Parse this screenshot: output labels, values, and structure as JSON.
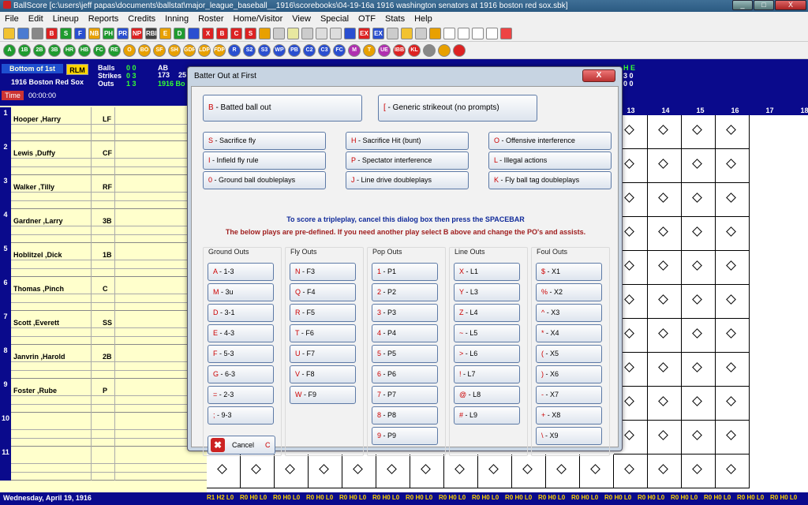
{
  "window": {
    "title": "BallScore   [c:\\users\\jeff papas\\documents\\ballstat\\major_league_baseball__1916\\scorebooks\\04-19-16a 1916 washington senators  at  1916 boston red sox.sbk]",
    "min": "_",
    "max": "□",
    "close": "X"
  },
  "menu": [
    "File",
    "Edit",
    "Lineup",
    "Reports",
    "Credits",
    "Inning",
    "Roster",
    "Home/Visitor",
    "View",
    "Special",
    "OTF",
    "Stats",
    "Help"
  ],
  "toolbar1": [
    {
      "t": "",
      "c": "#f2c230"
    },
    {
      "t": "",
      "c": "#4a7bd1"
    },
    {
      "t": "",
      "c": "#888"
    },
    {
      "t": "B",
      "c": "#d22"
    },
    {
      "t": "S",
      "c": "#1f9b2f"
    },
    {
      "t": "F",
      "c": "#2a4fd0"
    },
    {
      "t": "NB",
      "c": "#e8a000"
    },
    {
      "t": "PH",
      "c": "#1f9b2f"
    },
    {
      "t": "PR",
      "c": "#2a4fd0"
    },
    {
      "t": "NP",
      "c": "#d22"
    },
    {
      "t": "RBI",
      "c": "#444"
    },
    {
      "t": "E",
      "c": "#e8a000"
    },
    {
      "t": "D",
      "c": "#1f9b2f"
    },
    {
      "t": "",
      "c": "#2a4fd0"
    },
    {
      "t": "X",
      "c": "#d22"
    },
    {
      "t": "B",
      "c": "#d22"
    },
    {
      "t": "C",
      "c": "#d22"
    },
    {
      "t": "S",
      "c": "#d22"
    },
    {
      "t": "",
      "c": "#e8a000"
    },
    {
      "t": "",
      "c": "#ccc"
    },
    {
      "t": "",
      "c": "#e8e8a0"
    },
    {
      "t": "",
      "c": "#ccc"
    },
    {
      "t": "",
      "c": "#ddd"
    },
    {
      "t": "",
      "c": "#ddd"
    },
    {
      "t": "",
      "c": "#2a4fd0"
    },
    {
      "t": "EX",
      "c": "#d22"
    },
    {
      "t": "EX",
      "c": "#2a4fd0"
    },
    {
      "t": "",
      "c": "#ccc"
    },
    {
      "t": "",
      "c": "#f2c230"
    },
    {
      "t": "",
      "c": "#ccc"
    },
    {
      "t": "",
      "c": "#e8a000"
    },
    {
      "t": "",
      "c": "#fff"
    },
    {
      "t": "",
      "c": "#fff"
    },
    {
      "t": "",
      "c": "#fff"
    },
    {
      "t": "",
      "c": "#fff"
    },
    {
      "t": "",
      "c": "#e44"
    }
  ],
  "toolbar2": [
    {
      "t": "A",
      "c": "#1f9b2f"
    },
    {
      "t": "1B",
      "c": "#1f9b2f"
    },
    {
      "t": "2B",
      "c": "#1f9b2f"
    },
    {
      "t": "3B",
      "c": "#1f9b2f"
    },
    {
      "t": "HR",
      "c": "#1f9b2f"
    },
    {
      "t": "HB",
      "c": "#1f9b2f"
    },
    {
      "t": "FC",
      "c": "#1f9b2f"
    },
    {
      "t": "RE",
      "c": "#1f9b2f"
    },
    {
      "t": "O",
      "c": "#e8a000"
    },
    {
      "t": "BO",
      "c": "#e8a000"
    },
    {
      "t": "SF",
      "c": "#e8a000"
    },
    {
      "t": "SH",
      "c": "#e8a000"
    },
    {
      "t": "GDP",
      "c": "#e8a000"
    },
    {
      "t": "LDP",
      "c": "#e8a000"
    },
    {
      "t": "FDP",
      "c": "#e8a000"
    },
    {
      "t": "R",
      "c": "#2a4fd0"
    },
    {
      "t": "S2",
      "c": "#2a4fd0"
    },
    {
      "t": "S3",
      "c": "#2a4fd0"
    },
    {
      "t": "WP",
      "c": "#2a4fd0"
    },
    {
      "t": "PB",
      "c": "#2a4fd0"
    },
    {
      "t": "C2",
      "c": "#2a4fd0"
    },
    {
      "t": "C3",
      "c": "#2a4fd0"
    },
    {
      "t": "FC",
      "c": "#2a4fd0"
    },
    {
      "t": "M",
      "c": "#b02fb0"
    },
    {
      "t": "T",
      "c": "#e8a000"
    },
    {
      "t": "UE",
      "c": "#b02fb0"
    },
    {
      "t": "IBB",
      "c": "#d22"
    },
    {
      "t": "KL",
      "c": "#d22"
    },
    {
      "t": "",
      "c": "#888"
    },
    {
      "t": "",
      "c": "#e8a000"
    },
    {
      "t": "",
      "c": "#d22"
    }
  ],
  "scoreboard": {
    "inning": "Bottom of 1st",
    "rlm": "RLM",
    "team": "1916 Boston Red Sox",
    "balls_label": "Balls",
    "balls": "0 0",
    "strikes_label": "Strikes",
    "strikes": "0 3",
    "outs_label": "Outs",
    "outs": "1 3",
    "ab_label": "AB",
    "ab_value": "173",
    "ab_sub": "25",
    "team_short": "1916 Bo",
    "time_label": "Time",
    "time_value": "00:00:00",
    "right_top": "H  E",
    "right_mid": "3  0",
    "right_bot": "0  0"
  },
  "columns": [
    "13",
    "14",
    "15",
    "16",
    "17",
    "18"
  ],
  "lineup": [
    {
      "num": "1",
      "name": "Hooper ,Harry",
      "pos": "LF"
    },
    {
      "num": "2",
      "name": "Lewis ,Duffy",
      "pos": "CF"
    },
    {
      "num": "3",
      "name": "Walker ,Tilly",
      "pos": "RF"
    },
    {
      "num": "4",
      "name": "Gardner ,Larry",
      "pos": "3B"
    },
    {
      "num": "5",
      "name": "Hoblitzel ,Dick",
      "pos": "1B"
    },
    {
      "num": "6",
      "name": "Thomas ,Pinch",
      "pos": "C"
    },
    {
      "num": "7",
      "name": "Scott ,Everett",
      "pos": "SS"
    },
    {
      "num": "8",
      "name": "Janvrin ,Harold",
      "pos": "2B"
    },
    {
      "num": "9",
      "name": "Foster ,Rube",
      "pos": "P"
    },
    {
      "num": "10",
      "name": "",
      "pos": ""
    },
    {
      "num": "11",
      "name": "",
      "pos": ""
    }
  ],
  "bottom": {
    "date": "Wednesday, April 19, 1916",
    "first": "R1 H2 L0",
    "rest": "R0 H0 L0"
  },
  "dialog": {
    "title": "Batter Out at First",
    "close": "X",
    "top_buttons": [
      {
        "key": "B",
        "label": " - Batted ball out"
      },
      {
        "key": "[",
        "label": " - Generic strikeout  (no prompts)"
      }
    ],
    "options": [
      {
        "key": "S",
        "label": " - Sacrifice fly"
      },
      {
        "key": "H",
        "label": " - Sacrifice Hit  (bunt)"
      },
      {
        "key": "O",
        "label": " - Offensive interference"
      },
      {
        "key": "I",
        "label": " - Infield fly rule"
      },
      {
        "key": "P",
        "label": " - Spectator interference"
      },
      {
        "key": "L",
        "label": " - Illegal actions"
      },
      {
        "key": "0",
        "label": " - Ground ball doubleplays"
      },
      {
        "key": "J",
        "label": " - Line drive doubleplays"
      },
      {
        "key": "K",
        "label": " - Fly ball tag doubleplays"
      }
    ],
    "note_tripleplay": "To score a tripleplay, cancel this dialog box then press the SPACEBAR",
    "note_predefined": "The below plays are pre-defined. If you need another play select B above and change the PO's and assists.",
    "groups": [
      {
        "title": "Ground Outs",
        "items": [
          {
            "key": "A",
            "label": " - 1-3"
          },
          {
            "key": "M",
            "label": " - 3u"
          },
          {
            "key": "D",
            "label": " - 3-1"
          },
          {
            "key": "E",
            "label": " - 4-3"
          },
          {
            "key": "F",
            "label": " - 5-3"
          },
          {
            "key": "G",
            "label": " - 6-3"
          },
          {
            "key": "=",
            "label": " - 2-3"
          },
          {
            "key": ";",
            "label": " - 9-3"
          }
        ]
      },
      {
        "title": "Fly Outs",
        "items": [
          {
            "key": "N",
            "label": " - F3"
          },
          {
            "key": "Q",
            "label": " - F4"
          },
          {
            "key": "R",
            "label": " - F5"
          },
          {
            "key": "T",
            "label": " - F6"
          },
          {
            "key": "U",
            "label": " - F7"
          },
          {
            "key": "V",
            "label": " - F8"
          },
          {
            "key": "W",
            "label": " - F9"
          }
        ]
      },
      {
        "title": "Pop Outs",
        "items": [
          {
            "key": "1",
            "label": " - P1"
          },
          {
            "key": "2",
            "label": " - P2"
          },
          {
            "key": "3",
            "label": " - P3"
          },
          {
            "key": "4",
            "label": " - P4"
          },
          {
            "key": "5",
            "label": " - P5"
          },
          {
            "key": "6",
            "label": " - P6"
          },
          {
            "key": "7",
            "label": " - P7"
          },
          {
            "key": "8",
            "label": " - P8"
          },
          {
            "key": "9",
            "label": " - P9"
          }
        ]
      },
      {
        "title": "Line Outs",
        "items": [
          {
            "key": "X",
            "label": " - L1"
          },
          {
            "key": "Y",
            "label": " - L3"
          },
          {
            "key": "Z",
            "label": " - L4"
          },
          {
            "key": "~",
            "label": " - L5"
          },
          {
            "key": ">",
            "label": " - L6"
          },
          {
            "key": "!",
            "label": " - L7"
          },
          {
            "key": "@",
            "label": " - L8"
          },
          {
            "key": "#",
            "label": " - L9"
          }
        ]
      },
      {
        "title": "Foul Outs",
        "items": [
          {
            "key": "$",
            "label": " - X1"
          },
          {
            "key": "%",
            "label": " - X2"
          },
          {
            "key": "^",
            "label": " - X3"
          },
          {
            "key": "*",
            "label": " - X4"
          },
          {
            "key": "(",
            "label": " - X5"
          },
          {
            "key": ")",
            "label": " - X6"
          },
          {
            "key": "-",
            "label": " - X7"
          },
          {
            "key": "+",
            "label": " - X8"
          },
          {
            "key": "\\",
            "label": " - X9"
          }
        ]
      }
    ],
    "cancel": {
      "label": "Cancel",
      "key": "C"
    }
  }
}
